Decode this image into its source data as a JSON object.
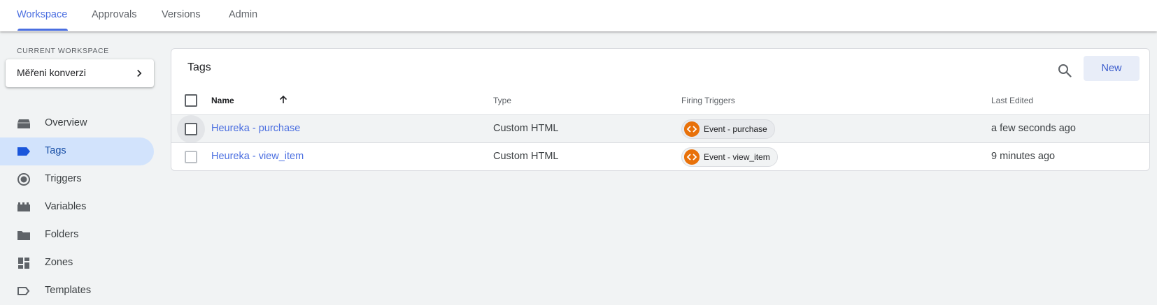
{
  "tabs": [
    {
      "label": "Workspace",
      "active": true
    },
    {
      "label": "Approvals",
      "active": false
    },
    {
      "label": "Versions",
      "active": false
    },
    {
      "label": "Admin",
      "active": false
    }
  ],
  "sidebar": {
    "workspace_label": "CURRENT WORKSPACE",
    "workspace_name": "Měřeni konverzi",
    "items": [
      {
        "label": "Overview",
        "icon": "overview-icon",
        "active": false
      },
      {
        "label": "Tags",
        "icon": "tag-icon",
        "active": true
      },
      {
        "label": "Triggers",
        "icon": "trigger-icon",
        "active": false
      },
      {
        "label": "Variables",
        "icon": "variables-icon",
        "active": false
      },
      {
        "label": "Folders",
        "icon": "folder-icon",
        "active": false
      },
      {
        "label": "Zones",
        "icon": "zones-icon",
        "active": false
      },
      {
        "label": "Templates",
        "icon": "template-icon",
        "active": false
      }
    ]
  },
  "main": {
    "title": "Tags",
    "new_label": "New",
    "columns": {
      "name": "Name",
      "type": "Type",
      "triggers": "Firing Triggers",
      "edited": "Last Edited"
    },
    "rows": [
      {
        "name": "Heureka - purchase",
        "type": "Custom HTML",
        "trigger": "Event - purchase",
        "edited": "a few seconds ago"
      },
      {
        "name": "Heureka - view_item",
        "type": "Custom HTML",
        "trigger": "Event - view_item",
        "edited": "9 minutes ago"
      }
    ]
  },
  "colors": {
    "accent": "#4a6ee0",
    "nav_active_bg": "#d2e3fc",
    "trigger_orange": "#e8710a",
    "page_bg": "#f1f3f4"
  }
}
